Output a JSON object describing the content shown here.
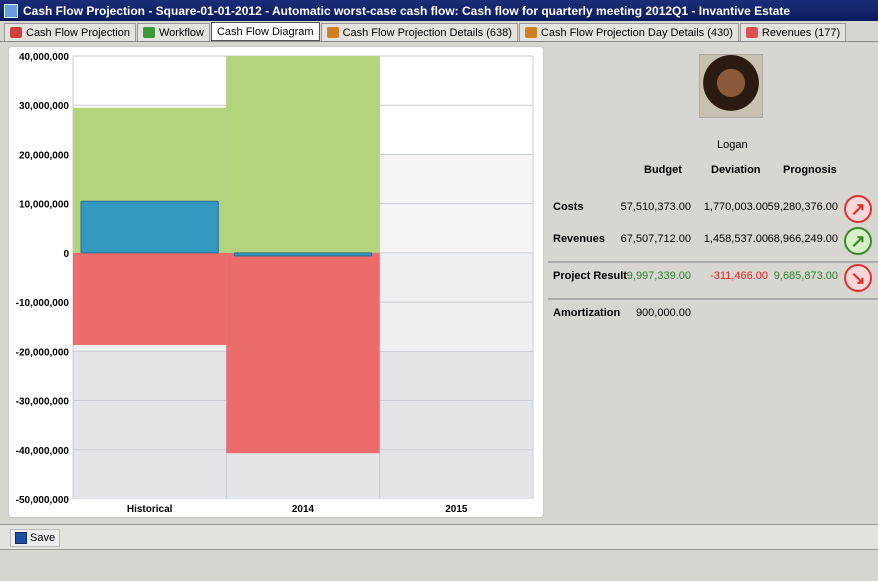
{
  "window": {
    "title": "Cash Flow Projection - Square-01-01-2012 - Automatic worst-case cash flow: Cash flow for quarterly meeting 2012Q1 - Invantive Estate"
  },
  "tabs": [
    {
      "label": "Cash Flow Projection",
      "icon": "chart-icon",
      "color": "#d04040"
    },
    {
      "label": "Workflow",
      "icon": "refresh-icon",
      "color": "#3a9a3a"
    },
    {
      "label": "Cash Flow Diagram",
      "icon": "",
      "color": ""
    },
    {
      "label": "Cash Flow Projection Details (638)",
      "icon": "details-icon",
      "color": "#d08020"
    },
    {
      "label": "Cash Flow Projection Day Details (430)",
      "icon": "details-icon",
      "color": "#d08020"
    },
    {
      "label": "Revenues (177)",
      "icon": "revenue-icon",
      "color": "#e05050"
    }
  ],
  "active_tab": 2,
  "summary": {
    "user": "Logan",
    "headers": {
      "budget": "Budget",
      "deviation": "Deviation",
      "prognosis": "Prognosis"
    },
    "rows": [
      {
        "label": "Costs",
        "budget": "57,510,373.00",
        "deviation": "1,770,003.00",
        "prognosis": "59,280,376.00",
        "trend": "up",
        "trend_color": "#e03030"
      },
      {
        "label": "Revenues",
        "budget": "67,507,712.00",
        "deviation": "1,458,537.00",
        "prognosis": "68,966,249.00",
        "trend": "up",
        "trend_color": "#3a8a2a"
      },
      {
        "label": "Project Result",
        "budget": "9,997,339.00",
        "deviation": "-311,466.00",
        "prognosis": "9,685,873.00",
        "trend": "down",
        "trend_color": "#e03030"
      },
      {
        "label": "Amortization",
        "budget": "900,000.00"
      }
    ],
    "colors": {
      "positive": "#2e7d2e",
      "negative": "#e02020"
    }
  },
  "toolbar": {
    "save_label": "Save"
  },
  "chart_data": {
    "type": "bar",
    "categories": [
      "Historical",
      "2014",
      "2015"
    ],
    "ylim": [
      -50000000,
      40000000
    ],
    "yticks": [
      "40,000,000",
      "30,000,000",
      "20,000,000",
      "10,000,000",
      "0",
      "-10,000,000",
      "-20,000,000",
      "-30,000,000",
      "-40,000,000",
      "-50,000,000"
    ],
    "series": [
      {
        "color": "#b3d47a",
        "values": [
          29500000,
          40000000,
          0
        ]
      },
      {
        "color": "#ec6b6b",
        "values": [
          -18700000,
          -40700000,
          0
        ]
      },
      {
        "color": "#3398bf",
        "values": [
          10500000,
          -600000,
          0
        ]
      }
    ],
    "grid": true
  }
}
